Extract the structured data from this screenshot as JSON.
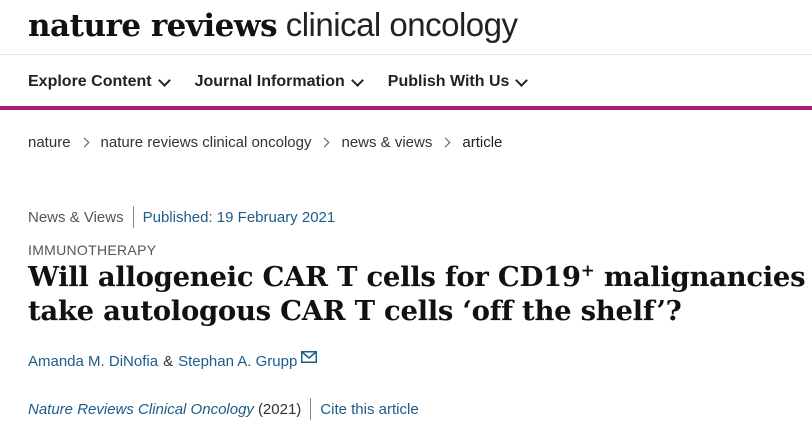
{
  "header": {
    "logo_bold": "nature reviews",
    "logo_light": "clinical oncology"
  },
  "nav": {
    "items": [
      {
        "label": "Explore Content"
      },
      {
        "label": "Journal Information"
      },
      {
        "label": "Publish With Us"
      }
    ],
    "accent_color": "#a6216f"
  },
  "breadcrumb": {
    "items": [
      "nature",
      "nature reviews clinical oncology",
      "news & views",
      "article"
    ]
  },
  "article": {
    "type": "News & Views",
    "published": "Published: 19 February 2021",
    "subject": "IMMUNOTHERAPY",
    "title_part1": "Will allogeneic CAR T cells for CD19",
    "title_sup": "+",
    "title_part2": " malignancies take autologous CAR T cells ‘off the shelf’?",
    "authors": [
      "Amanda M. DiNofia",
      "Stephan A. Grupp"
    ],
    "author_separator": "&",
    "journal": "Nature Reviews Clinical Oncology",
    "year": "(2021)",
    "cite_label": "Cite this article"
  },
  "colors": {
    "link": "#1a5d8a",
    "text": "#222222"
  }
}
